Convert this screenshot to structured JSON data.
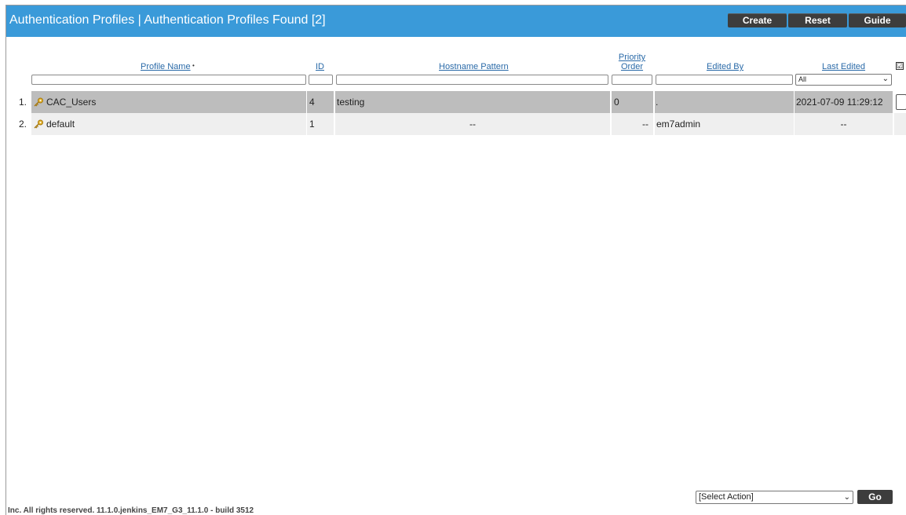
{
  "header": {
    "title": "Authentication Profiles | Authentication Profiles Found [2]",
    "buttons": {
      "create": "Create",
      "reset": "Reset",
      "guide": "Guide"
    }
  },
  "columns": {
    "profile_name": "Profile Name",
    "id": "ID",
    "hostname_pattern": "Hostname Pattern",
    "priority_order_line1": "Priority",
    "priority_order_line2": "Order",
    "edited_by": "Edited By",
    "last_edited": "Last Edited",
    "sort_indicator": "•"
  },
  "filters": {
    "last_edited_selected": "All",
    "check_all": "☑"
  },
  "rows": [
    {
      "num": "1.",
      "name": "CAC_Users",
      "id": "4",
      "hostname": "testing",
      "priority": "0",
      "edited_by": ".",
      "last_edited": "2021-07-09 11:29:12"
    },
    {
      "num": "2.",
      "name": "default",
      "id": "1",
      "hostname": "--",
      "priority": "--",
      "edited_by": "em7admin",
      "last_edited": "--"
    }
  ],
  "actions": {
    "select_label": "[Select Action]",
    "go_label": "Go"
  },
  "footer": {
    "text": "Inc. All rights reserved. 11.1.0.jenkins_EM7_G3_11.1.0 - build 3512"
  },
  "colors": {
    "titlebar": "#3a9ad9",
    "button": "#3d3d3d",
    "row_selected": "#bdbdbd",
    "row_alt": "#efefef",
    "link": "#2a6aa8"
  }
}
